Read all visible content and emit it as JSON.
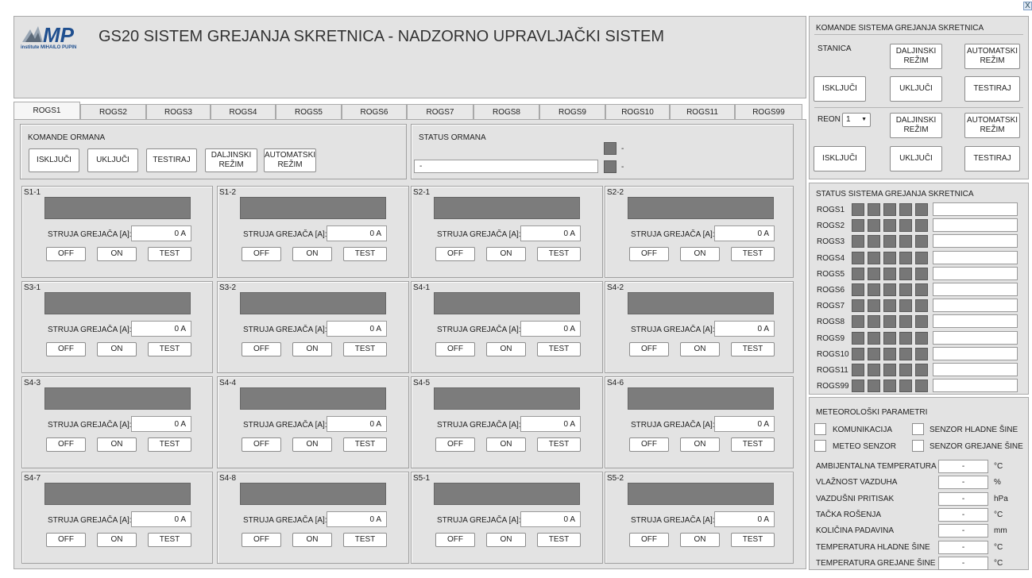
{
  "header": {
    "logo_text": "MP",
    "logo_sub": "institute  MIHAILO PUPIN",
    "title": "GS20 SISTEM GREJANJA SKRETNICA - NADZORNO UPRAVLJAČKI SISTEM",
    "close": "X"
  },
  "tabs": [
    "ROGS1",
    "ROGS2",
    "ROGS3",
    "ROGS4",
    "ROGS5",
    "ROGS6",
    "ROGS7",
    "ROGS8",
    "ROGS9",
    "ROGS10",
    "ROGS11",
    "ROGS99"
  ],
  "komande_ormana": {
    "title": "KOMANDE ORMANA",
    "buttons": [
      "ISKLJUČI",
      "UKLJUČI",
      "TESTIRAJ",
      "DALJINSKI\nREŽIM",
      "AUTOMATSKI\nREŽIM"
    ]
  },
  "status_ormana": {
    "title": "STATUS ORMANA",
    "field": "-",
    "led1_label": "-",
    "led2_label": "-"
  },
  "heater_labels": {
    "current": "STRUJA GREJAČA [A]:",
    "off": "OFF",
    "on": "ON",
    "test": "TEST"
  },
  "heaters": [
    {
      "id": "S1-1",
      "value": "0 A"
    },
    {
      "id": "S1-2",
      "value": "0 A"
    },
    {
      "id": "S2-1",
      "value": "0 A"
    },
    {
      "id": "S2-2",
      "value": "0 A"
    },
    {
      "id": "S3-1",
      "value": "0 A"
    },
    {
      "id": "S3-2",
      "value": "0 A"
    },
    {
      "id": "S4-1",
      "value": "0 A"
    },
    {
      "id": "S4-2",
      "value": "0 A"
    },
    {
      "id": "S4-3",
      "value": "0 A"
    },
    {
      "id": "S4-4",
      "value": "0 A"
    },
    {
      "id": "S4-5",
      "value": "0 A"
    },
    {
      "id": "S4-6",
      "value": "0 A"
    },
    {
      "id": "S4-7",
      "value": "0 A"
    },
    {
      "id": "S4-8",
      "value": "0 A"
    },
    {
      "id": "S5-1",
      "value": "0 A"
    },
    {
      "id": "S5-2",
      "value": "0 A"
    }
  ],
  "system_commands": {
    "title": "KOMANDE SISTEMA GREJANJA SKRETNICA",
    "stanica_label": "STANICA",
    "reon_label": "REON",
    "reon_value": "1",
    "daljinski": "DALJINSKI\nREŽIM",
    "automatski": "AUTOMATSKI\nREŽIM",
    "iskljuci": "ISKLJUČI",
    "ukljuci": "UKLJUČI",
    "testiraj": "TESTIRAJ"
  },
  "system_status": {
    "title": "STATUS SISTEMA GREJANJA SKRETNICA",
    "rows": [
      {
        "label": "ROGS1",
        "value": ""
      },
      {
        "label": "ROGS2",
        "value": ""
      },
      {
        "label": "ROGS3",
        "value": ""
      },
      {
        "label": "ROGS4",
        "value": ""
      },
      {
        "label": "ROGS5",
        "value": ""
      },
      {
        "label": "ROGS6",
        "value": ""
      },
      {
        "label": "ROGS7",
        "value": ""
      },
      {
        "label": "ROGS8",
        "value": ""
      },
      {
        "label": "ROGS9",
        "value": ""
      },
      {
        "label": "ROGS10",
        "value": ""
      },
      {
        "label": "ROGS11",
        "value": ""
      },
      {
        "label": "ROGS99",
        "value": ""
      }
    ]
  },
  "meteo": {
    "title": "METEOROLOŠKI PARAMETRI",
    "checks": [
      "KOMUNIKACIJA",
      "SENZOR HLADNE ŠINE",
      "METEO SENZOR",
      "SENZOR GREJANE ŠINE"
    ],
    "params": [
      {
        "label": "AMBIJENTALNA TEMPERATURA",
        "value": "-",
        "unit": "°C"
      },
      {
        "label": "VLAŽNOST VAZDUHA",
        "value": "-",
        "unit": "%"
      },
      {
        "label": "VAZDUŠNI PRITISAK",
        "value": "-",
        "unit": "hPa"
      },
      {
        "label": "TAČKA ROŠENJA",
        "value": "-",
        "unit": "°C"
      },
      {
        "label": "KOLIČINA PADAVINA",
        "value": "-",
        "unit": "mm"
      },
      {
        "label": "TEMPERATURA HLADNE ŠINE",
        "value": "-",
        "unit": "°C"
      },
      {
        "label": "TEMPERATURA GREJANE ŠINE",
        "value": "-",
        "unit": "°C"
      }
    ]
  }
}
